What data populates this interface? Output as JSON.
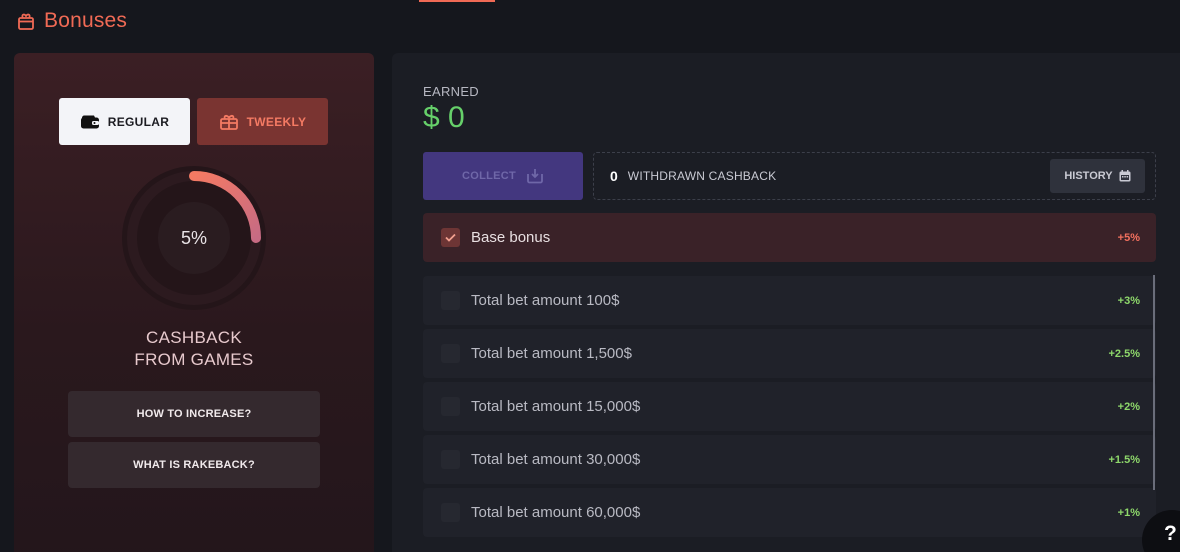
{
  "header": {
    "title": "Bonuses",
    "icon": "gift-box-icon"
  },
  "left_panel": {
    "modes": [
      {
        "label": "REGULAR",
        "icon": "wallet-icon",
        "active": true
      },
      {
        "label": "TWEEKLY",
        "icon": "gift-box-icon",
        "active": false
      }
    ],
    "gauge": {
      "value": "5%",
      "fraction": 0.25,
      "colors": [
        "#f47a63",
        "#c76b83"
      ]
    },
    "cashback_label": {
      "line1": "CASHBACK",
      "line2": "FROM GAMES"
    },
    "buttons": {
      "how_to_increase": "HOW TO INCREASE?",
      "what_is_rakeback": "WHAT IS RAKEBACK?"
    }
  },
  "right_panel": {
    "earned_label": "EARNED",
    "earned_value": "$ 0",
    "collect_label": "COLLECT",
    "withdrawn": {
      "count": "0",
      "label": "WITHDRAWN CASHBACK"
    },
    "history_label": "HISTORY",
    "bonuses": [
      {
        "label": "Base bonus",
        "value": "+5%",
        "checked": true
      },
      {
        "label": "Total bet amount 100$",
        "value": "+3%",
        "checked": false
      },
      {
        "label": "Total bet amount 1,500$",
        "value": "+2.5%",
        "checked": false
      },
      {
        "label": "Total bet amount 15,000$",
        "value": "+2%",
        "checked": false
      },
      {
        "label": "Total bet amount 30,000$",
        "value": "+1.5%",
        "checked": false
      },
      {
        "label": "Total bet amount 60,000$",
        "value": "+1%",
        "checked": false
      }
    ]
  },
  "help": {
    "label": "?"
  },
  "colors": {
    "accent": "#f06a55",
    "earned": "#66d06a",
    "bonus_positive": "#8ed86b",
    "collect_bg": "#43377f"
  }
}
